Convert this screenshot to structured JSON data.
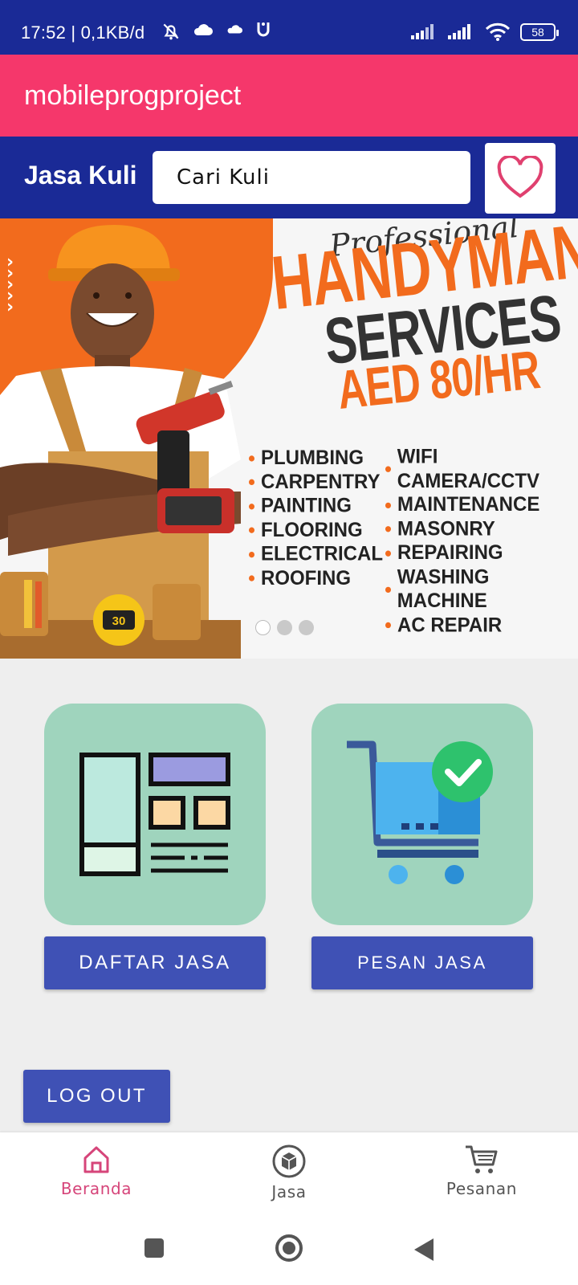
{
  "status_bar": {
    "time": "17:52 | 0,1KB/d",
    "battery": "58",
    "icons": [
      "bell-off-icon",
      "cloud-icon",
      "cloud-small-icon",
      "app-icon",
      "signal-icon",
      "signal-icon",
      "wifi-icon",
      "battery-icon"
    ]
  },
  "app_bar": {
    "title": "mobileprogproject"
  },
  "search_row": {
    "brand": "Jasa Kuli",
    "search_placeholder": "Cari Kuli",
    "favorite_icon": "heart-icon"
  },
  "banner": {
    "script_text": "Professional",
    "headline": "HANDYMAN",
    "subheadline": "SERVICES",
    "price": "AED 80/HR",
    "services_col1": [
      "PLUMBING",
      "CARPENTRY",
      "PAINTING",
      "FLOORING",
      "ELECTRICAL",
      "ROOFING"
    ],
    "services_col2": [
      "WIFI CAMERA/CCTV",
      "MAINTENANCE",
      "MASONRY",
      "REPAIRING",
      "WASHING MACHINE",
      "AC REPAIR"
    ],
    "carousel": {
      "page_count": 3,
      "active_index": 0
    },
    "tool_label": "30"
  },
  "actions": {
    "list_tile_icon": "catalog-layout-icon",
    "list_button": "DAFTAR JASA",
    "order_tile_icon": "cart-check-icon",
    "order_button": "PESAN JASA"
  },
  "logout_button": "LOG OUT",
  "bottom_nav": {
    "items": [
      {
        "label": "Beranda",
        "icon": "home-icon",
        "active": true
      },
      {
        "label": "Jasa",
        "icon": "box-icon",
        "active": false
      },
      {
        "label": "Pesanan",
        "icon": "cart-icon",
        "active": false
      }
    ],
    "active_color": "#d6457a"
  },
  "system_nav": {
    "icons": [
      "recents-icon",
      "home-circle-icon",
      "back-icon"
    ]
  },
  "colors": {
    "status_bar": "#1a2a96",
    "app_bar": "#f5376b",
    "search_row": "#1a2a96",
    "button": "#3f51b5",
    "tile": "#9fd4bd",
    "banner_accent": "#f26b1d"
  }
}
